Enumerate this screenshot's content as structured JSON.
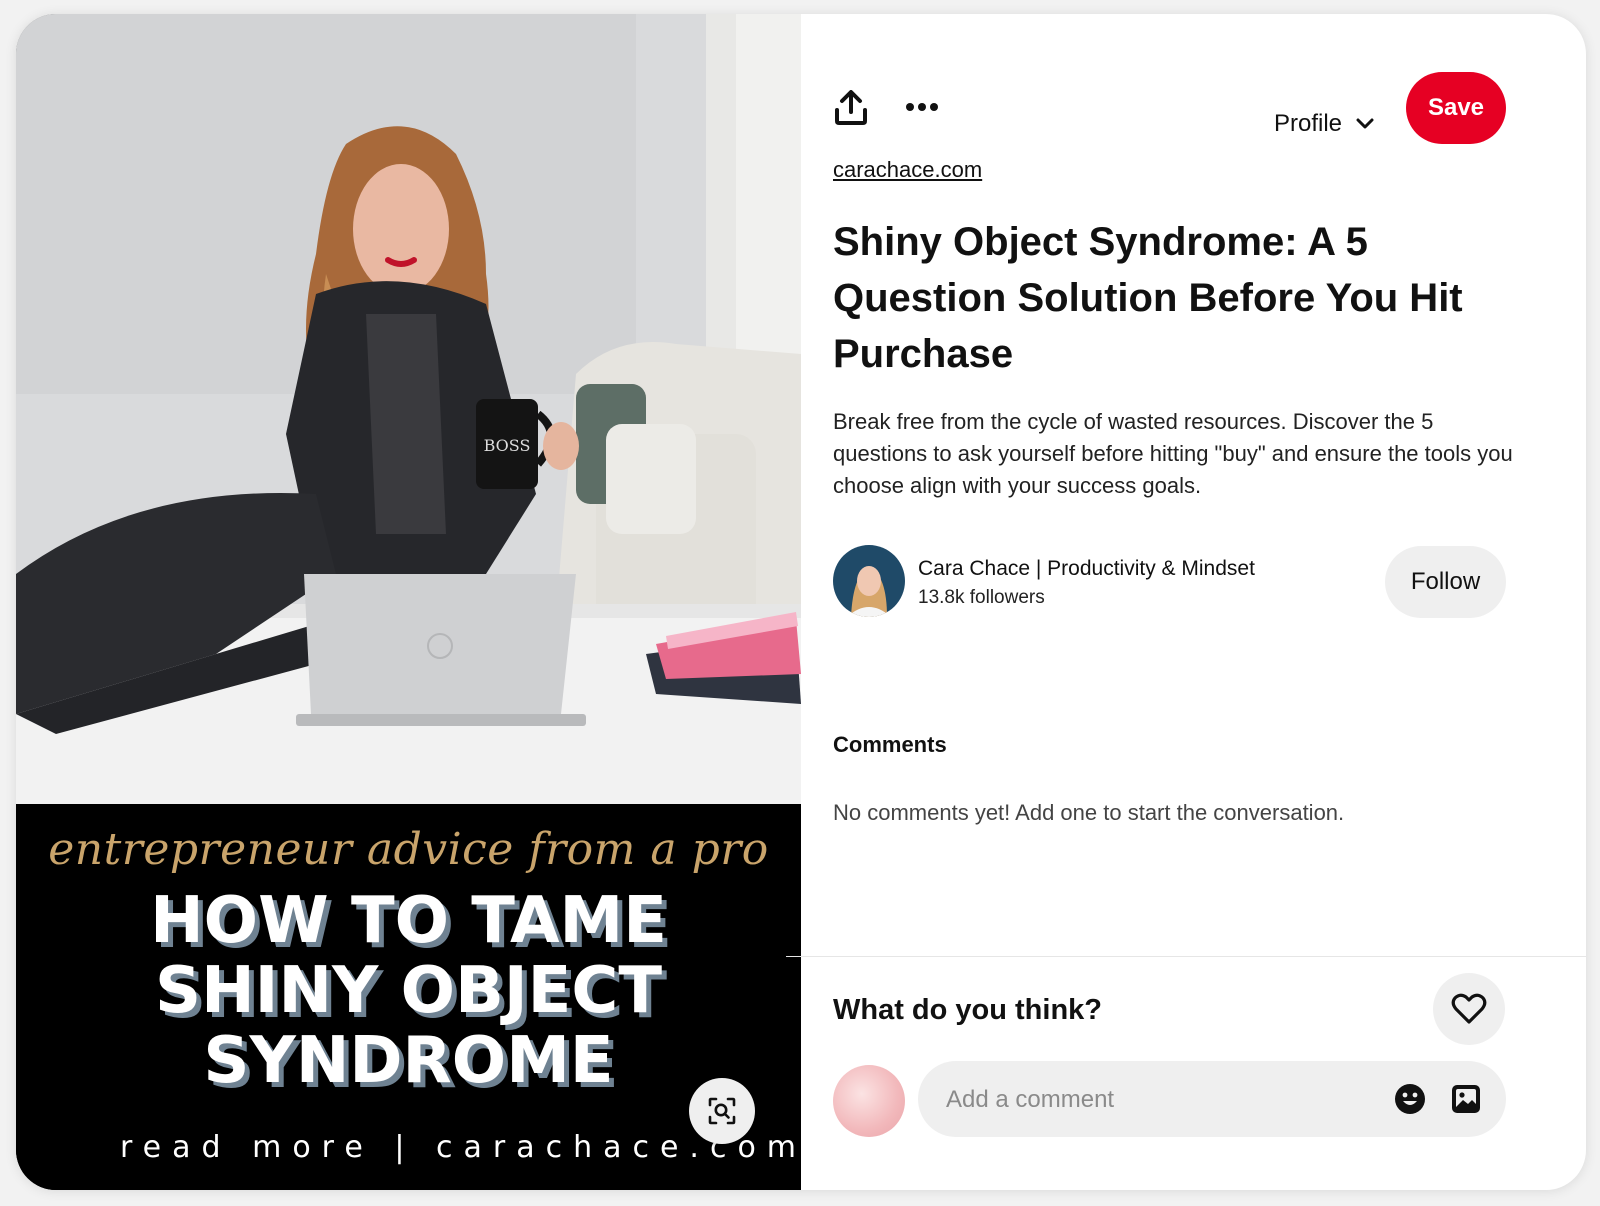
{
  "pin": {
    "banner_script": "entrepreneur advice from a pro",
    "banner_headline": [
      "HOW TO TAME",
      "SHINY OBJECT",
      "SYNDROME"
    ],
    "banner_footer": "read more | carachace.com",
    "mug_text": "BOSS"
  },
  "toolbar": {
    "share_icon": "share-icon",
    "more_icon": "more-options-icon",
    "profile_label": "Profile",
    "save_label": "Save"
  },
  "details": {
    "source": "carachace.com",
    "title": "Shiny Object Syndrome: A 5 Question Solution Before You Hit Purchase",
    "description": "Break free from the cycle of wasted resources. Discover the 5 questions to ask yourself before hitting \"buy\" and ensure the tools you choose align with your success goals."
  },
  "creator": {
    "name": "Cara Chace | Productivity & Mindset",
    "followers": "13.8k followers",
    "follow_label": "Follow"
  },
  "comments": {
    "heading": "Comments",
    "empty_text": "No comments yet! Add one to start the conversation."
  },
  "composer": {
    "prompt": "What do you think?",
    "placeholder": "Add a comment"
  },
  "colors": {
    "save": "#e60023",
    "button_bg": "#efefef",
    "script_gold": "#c9a46b",
    "headline_shadow": "#6f8292"
  }
}
